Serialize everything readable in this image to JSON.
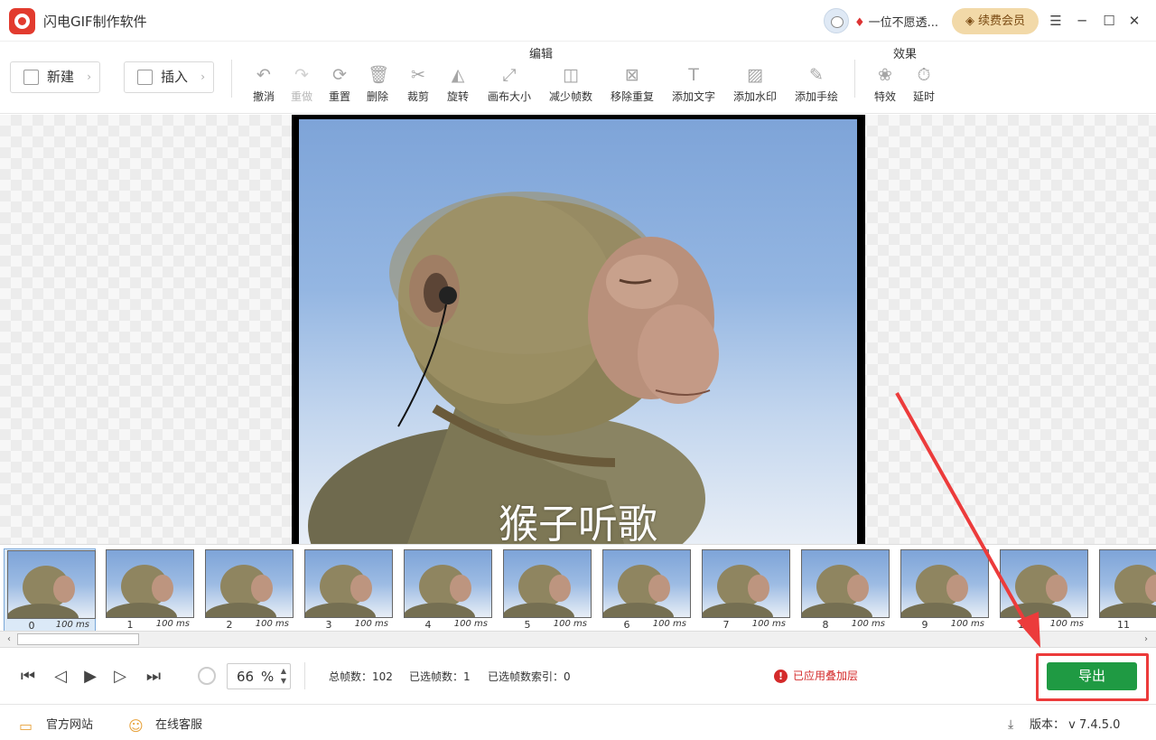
{
  "app": {
    "title": "闪电GIF制作软件"
  },
  "user": {
    "name": "一位不愿透...",
    "renew_label": "续费会员"
  },
  "window_controls": {
    "menu": "☰",
    "minimize": "─",
    "maximize": "☐",
    "close": "✕"
  },
  "toolbar": {
    "new_label": "新建",
    "insert_label": "插入",
    "edit_group": "编辑",
    "effects_group": "效果",
    "tools": [
      {
        "label": "撤消",
        "icon": "undo-icon",
        "glyph": "↶"
      },
      {
        "label": "重做",
        "icon": "redo-icon",
        "glyph": "↷"
      },
      {
        "label": "重置",
        "icon": "reset-icon",
        "glyph": "⟳"
      },
      {
        "label": "删除",
        "icon": "delete-icon",
        "glyph": "🗑"
      },
      {
        "label": "裁剪",
        "icon": "crop-icon",
        "glyph": "✂"
      },
      {
        "label": "旋转",
        "icon": "rotate-icon",
        "glyph": "◭"
      },
      {
        "label": "画布大小",
        "icon": "canvas-size-icon",
        "glyph": "⤢"
      },
      {
        "label": "减少帧数",
        "icon": "reduce-frames-icon",
        "glyph": "◫"
      },
      {
        "label": "移除重复",
        "icon": "remove-duplicate-icon",
        "glyph": "⊠"
      },
      {
        "label": "添加文字",
        "icon": "add-text-icon",
        "glyph": "T"
      },
      {
        "label": "添加水印",
        "icon": "add-watermark-icon",
        "glyph": "▨"
      },
      {
        "label": "添加手绘",
        "icon": "add-drawing-icon",
        "glyph": "✎"
      }
    ],
    "effect_tools": [
      {
        "label": "特效",
        "icon": "effects-icon",
        "glyph": "❀"
      },
      {
        "label": "延时",
        "icon": "delay-icon",
        "glyph": "⏱"
      }
    ]
  },
  "preview": {
    "caption": "猴子听歌"
  },
  "frames": [
    {
      "num": "0",
      "dur": "100 ms"
    },
    {
      "num": "1",
      "dur": "100 ms"
    },
    {
      "num": "2",
      "dur": "100 ms"
    },
    {
      "num": "3",
      "dur": "100 ms"
    },
    {
      "num": "4",
      "dur": "100 ms"
    },
    {
      "num": "5",
      "dur": "100 ms"
    },
    {
      "num": "6",
      "dur": "100 ms"
    },
    {
      "num": "7",
      "dur": "100 ms"
    },
    {
      "num": "8",
      "dur": "100 ms"
    },
    {
      "num": "9",
      "dur": "100 ms"
    },
    {
      "num": "10",
      "dur": "100 ms"
    },
    {
      "num": "11",
      "dur": ""
    }
  ],
  "controls": {
    "zoom_value": "66",
    "zoom_unit": "%",
    "total_frames": "总帧数：102",
    "selected_frames": "已选帧数：1",
    "selected_index": "已选帧数索引：0",
    "warning": "已应用叠加层",
    "export_label": "导出"
  },
  "statusbar": {
    "website": "官方网站",
    "support": "在线客服",
    "version": "版本： v 7.4.5.0"
  },
  "colors": {
    "brand": "#e23b2e",
    "export": "#1f9a43",
    "highlight": "#ec3b3b"
  }
}
